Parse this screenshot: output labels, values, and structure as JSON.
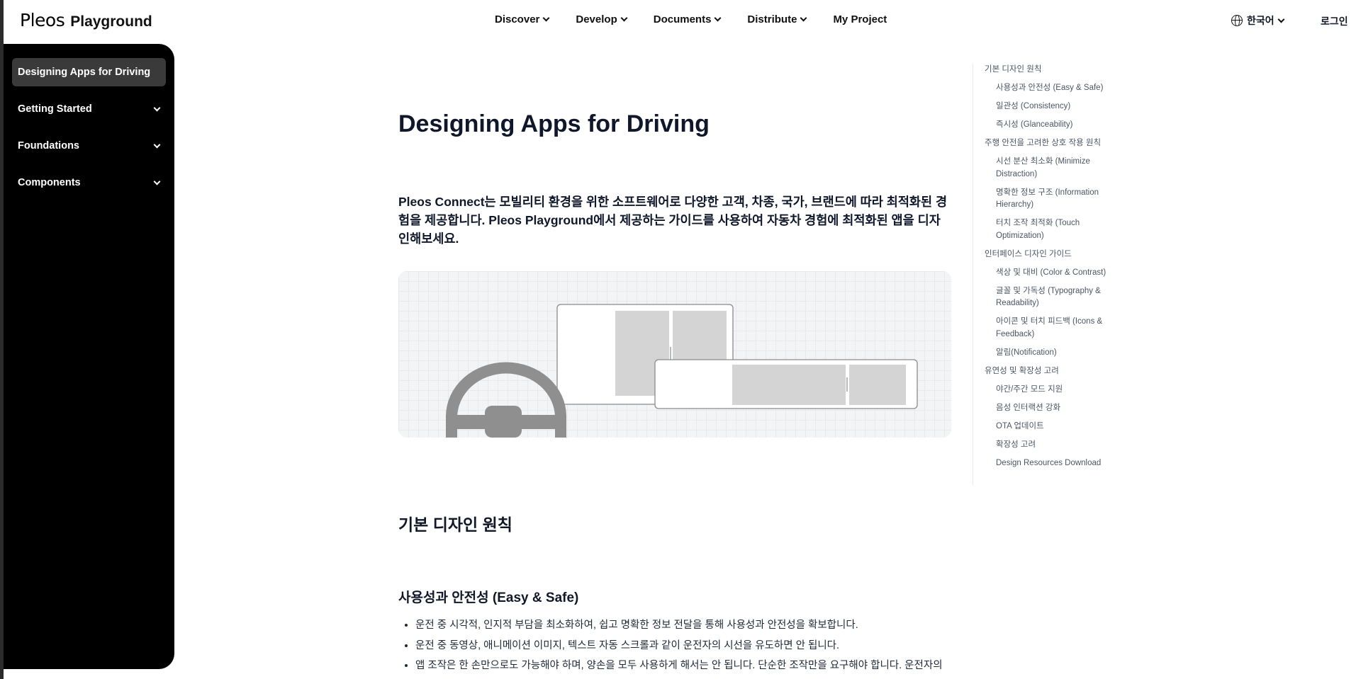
{
  "header": {
    "logo_mark": "Pleos",
    "logo_text": "Playground",
    "nav": [
      {
        "label": "Discover",
        "dropdown": true
      },
      {
        "label": "Develop",
        "dropdown": true
      },
      {
        "label": "Documents",
        "dropdown": true
      },
      {
        "label": "Distribute",
        "dropdown": true
      },
      {
        "label": "My Project",
        "dropdown": false
      }
    ],
    "language": "한국어",
    "login": "로그인"
  },
  "sidebar": {
    "items": [
      {
        "label": "Designing Apps for Driving",
        "active": true
      },
      {
        "label": "Getting Started",
        "expandable": true
      },
      {
        "label": "Foundations",
        "expandable": true
      },
      {
        "label": "Components",
        "expandable": true
      }
    ]
  },
  "main": {
    "title": "Designing Apps for Driving",
    "intro": "Pleos Connect는 모빌리티 환경을 위한 소프트웨어로 다양한 고객, 차종, 국가, 브랜드에 따라 최적화된 경험을 제공합니다. Pleos Playground에서 제공하는 가이드를 사용하여 자동차 경험에 최적화된 앱을 디자인해보세요.",
    "section_title": "기본 디자인 원칙",
    "subsection_title": "사용성과 안전성 (Easy & Safe)",
    "bullets": [
      "운전 중 시각적, 인지적 부담을 최소화하여, 쉽고 명확한 정보 전달을 통해 사용성과 안전성을 확보합니다.",
      "운전 중 동영상, 애니메이션 이미지, 텍스트 자동 스크롤과 같이 운전자의 시선을 유도하면 안 됩니다.",
      "앱 조작은 한 손만으로도 가능해야 하며, 양손을 모두 사용하게 해서는 안 됩니다. 단순한 조작만을 요구해야 합니다. 운전자의 손이나 발을 움직이는 동작을 유도해서는 안 됩니다."
    ]
  },
  "toc": [
    {
      "label": "기본 디자인 원칙",
      "level": 1
    },
    {
      "label": "사용성과 안전성 (Easy & Safe)",
      "level": 2
    },
    {
      "label": "일관성 (Consistency)",
      "level": 2
    },
    {
      "label": "즉시성 (Glanceability)",
      "level": 2
    },
    {
      "label": "주행 안전을 고려한 상호 작용 원칙",
      "level": 1
    },
    {
      "label": "시선 분산 최소화 (Minimize Distraction)",
      "level": 2
    },
    {
      "label": "명확한 정보 구조 (Information Hierarchy)",
      "level": 2
    },
    {
      "label": "터치 조작 최적화 (Touch Optimization)",
      "level": 2
    },
    {
      "label": "인터페이스 디자인 가이드",
      "level": 1
    },
    {
      "label": "색상 및 대비 (Color & Contrast)",
      "level": 2
    },
    {
      "label": "글꼴 및 가독성 (Typography & Readability)",
      "level": 2
    },
    {
      "label": "아이콘 및 터치 피드백 (Icons & Feedback)",
      "level": 2
    },
    {
      "label": "알림(Notification)",
      "level": 2
    },
    {
      "label": "유연성 및 확장성 고려",
      "level": 1
    },
    {
      "label": "야간/주간 모드 지원",
      "level": 2
    },
    {
      "label": "음성 인터랙션 강화",
      "level": 2
    },
    {
      "label": "OTA 업데이트",
      "level": 2
    },
    {
      "label": "확장성 고려",
      "level": 2
    },
    {
      "label": "Design Resources Download",
      "level": 2
    }
  ],
  "colors": {
    "sidebar_bg": "#000000",
    "sidebar_active": "#3a3a3a",
    "text_primary": "#0f172a",
    "toc_text": "#4b5563",
    "illustration_bg": "#f3f4f6"
  }
}
